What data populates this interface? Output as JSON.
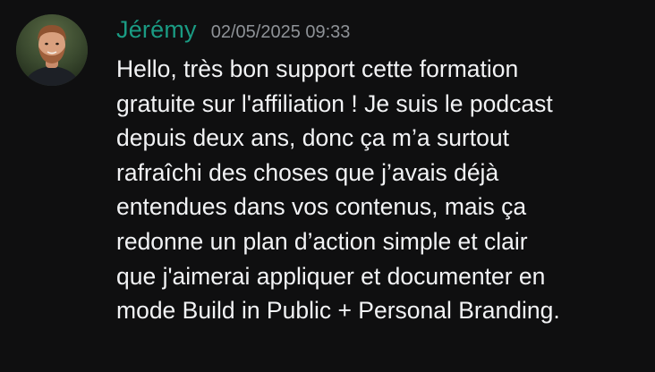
{
  "message": {
    "author": "Jérémy",
    "timestamp": "02/05/2025 09:33",
    "avatar_icon": "user-avatar-photo",
    "author_color": "#1a9b83",
    "lines": [
      "Hello, très bon support cette formation",
      "gratuite sur l'affiliation ! Je suis le podcast",
      "depuis deux ans, donc ça m’a surtout",
      "rafraîchi des choses que j’avais déjà",
      "entendues dans vos contenus, mais ça",
      "redonne un plan d’action simple et clair",
      "que j'aimerai appliquer et documenter en",
      "mode Build in Public + Personal Branding."
    ]
  }
}
